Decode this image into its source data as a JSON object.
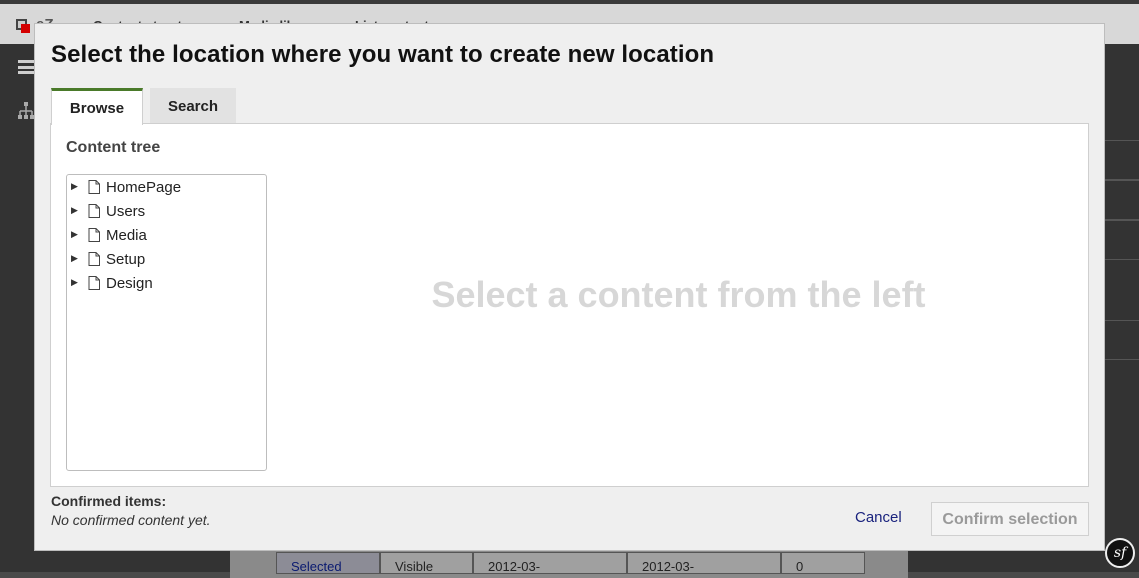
{
  "background": {
    "nav": [
      "Content structure",
      "Media library",
      "List contents"
    ],
    "table_row": [
      "Selected",
      "Visible",
      "2012-03-",
      "2012-03-",
      "0"
    ]
  },
  "modal": {
    "title": "Select the location where you want to create new location",
    "tabs": [
      {
        "label": "Browse",
        "active": true
      },
      {
        "label": "Search",
        "active": false
      }
    ],
    "tree": {
      "heading": "Content tree",
      "items": [
        {
          "label": "HomePage",
          "icon": "document-icon"
        },
        {
          "label": "Users",
          "icon": "document-icon"
        },
        {
          "label": "Media",
          "icon": "document-icon"
        },
        {
          "label": "Setup",
          "icon": "document-icon"
        },
        {
          "label": "Design",
          "icon": "document-icon"
        }
      ]
    },
    "placeholder": "Select a content from the left",
    "confirmed": {
      "label": "Confirmed items:",
      "empty_text": "No confirmed content yet."
    },
    "actions": {
      "cancel": "Cancel",
      "confirm": "Confirm selection"
    }
  },
  "colors": {
    "active_tab_accent": "#4a7a2a",
    "link": "#1a237e",
    "placeholder_text": "#d7d7d7"
  }
}
